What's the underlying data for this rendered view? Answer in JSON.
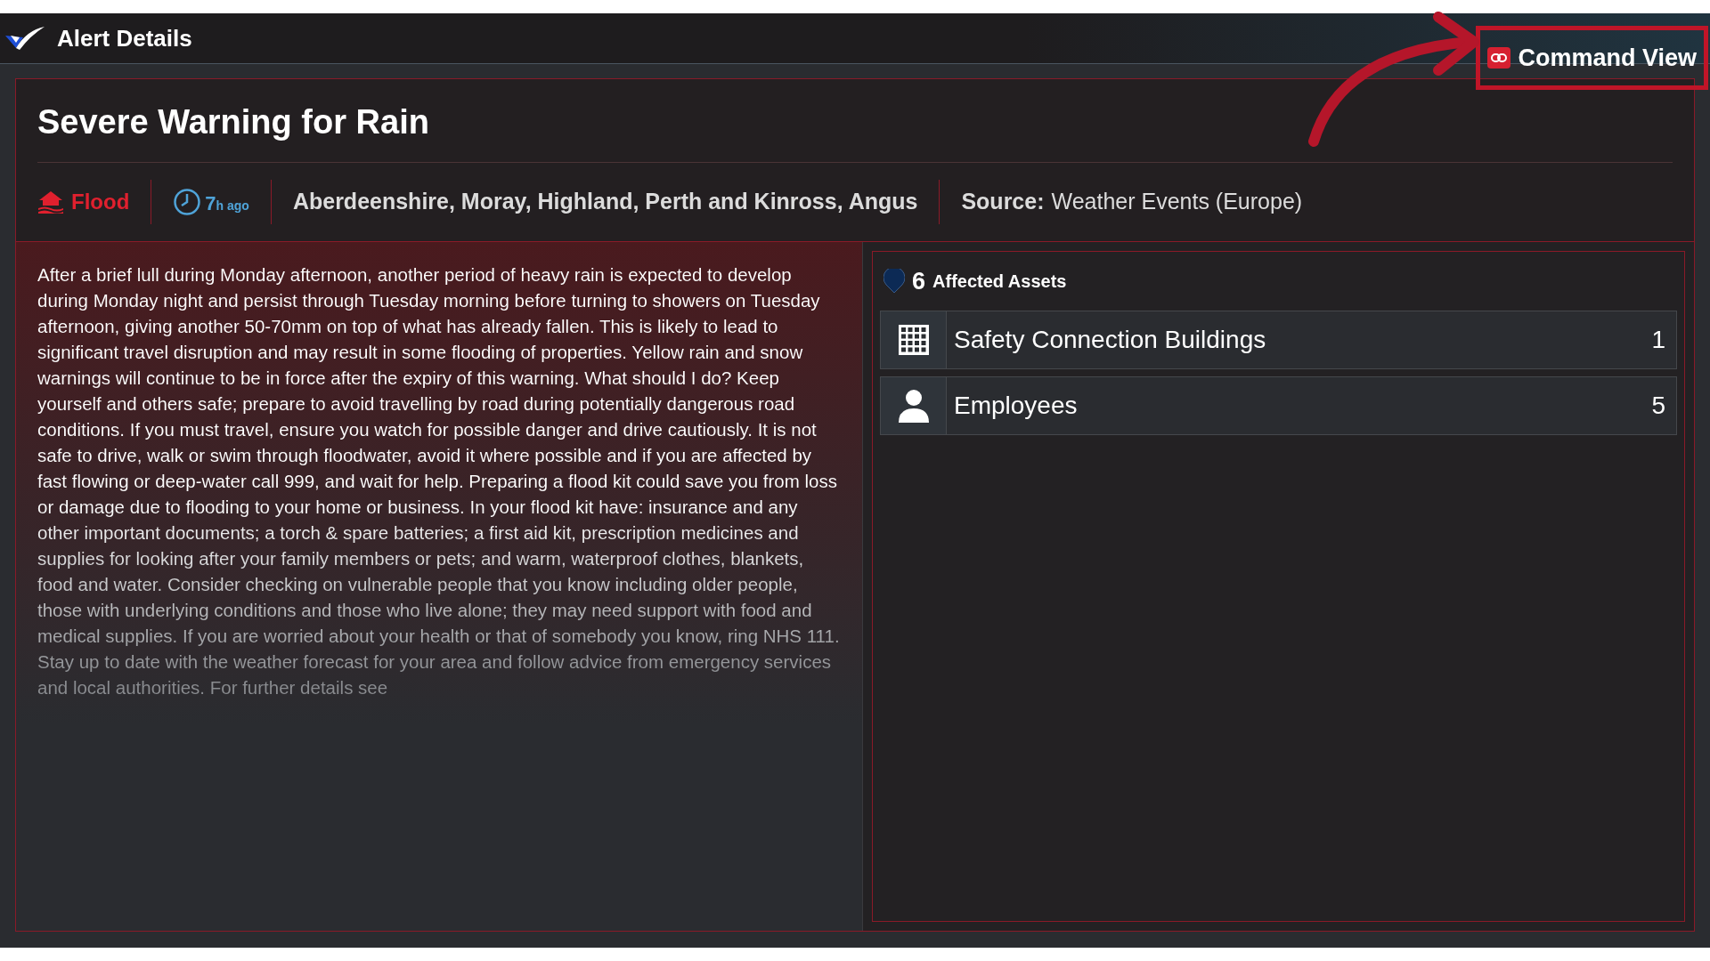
{
  "header": {
    "title": "Alert Details",
    "command_button": {
      "label": "Command View",
      "highlighted": true
    }
  },
  "alert": {
    "title": "Severe Warning for Rain",
    "type": "Flood",
    "age_value": "7",
    "age_unit": "h ago",
    "regions": "Aberdeenshire, Moray, Highland, Perth and Kinross, Angus",
    "source_label": "Source:",
    "source": "Weather Events (Europe)",
    "description": "After a brief lull during Monday afternoon, another period of heavy rain is expected to develop during Monday night and persist through Tuesday morning before turning to showers on Tuesday afternoon, giving another 50-70mm on top of what has already fallen. This is likely to lead to significant travel disruption and may result in some flooding of properties. Yellow rain and snow warnings will continue to be in force after the expiry of this warning. What should I do? Keep yourself and others safe; prepare to avoid travelling by road during potentially dangerous road conditions. If you must travel, ensure you watch for possible danger and drive cautiously. It is not safe to drive, walk or swim through floodwater, avoid it where possible and if you are affected by fast flowing or deep-water call 999, and wait for help. Preparing a flood kit could save you from loss or damage due to flooding to your home or business. In your flood kit have: insurance and any other important documents; a torch & spare batteries; a first aid kit, prescription medicines and supplies for looking after your family members or pets; and warm, waterproof clothes, blankets, food and water. Consider checking on vulnerable people that you know including older people, those with underlying conditions and those who live alone; they may need support with food and medical supplies. If you are worried about your health or that of somebody you know, ring NHS 111. Stay up to date with the weather forecast for your area and follow advice from emergency services and local authorities. For further details see"
  },
  "assets": {
    "count": "6",
    "label": "Affected Assets",
    "items": [
      {
        "kind": "building",
        "name": "Safety Connection Buildings",
        "count": "1"
      },
      {
        "kind": "person",
        "name": "Employees",
        "count": "5"
      }
    ]
  }
}
